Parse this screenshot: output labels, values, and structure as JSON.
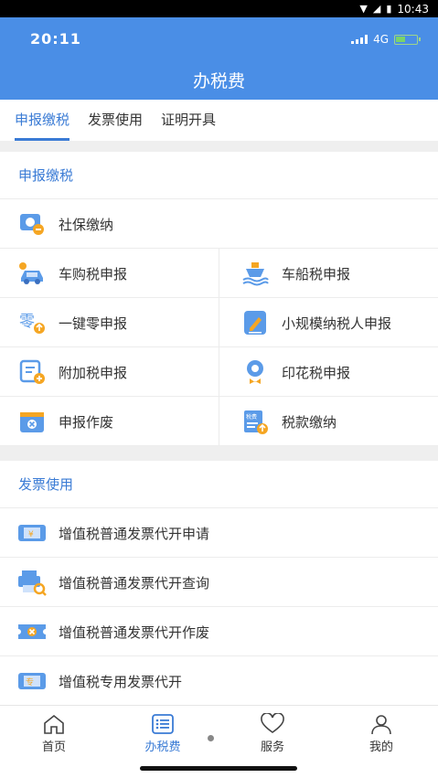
{
  "system_bar": {
    "time": "10:43"
  },
  "status_bar": {
    "time": "20:11",
    "network": "4G"
  },
  "header": {
    "title": "办税费"
  },
  "tabs": [
    {
      "label": "申报缴税",
      "active": true
    },
    {
      "label": "发票使用",
      "active": false
    },
    {
      "label": "证明开具",
      "active": false
    }
  ],
  "section_declare": {
    "title": "申报缴税",
    "items": [
      {
        "label": "社保缴纳",
        "icon": "social-security-icon"
      },
      {
        "label": "车购税申报",
        "icon": "car-icon"
      },
      {
        "label": "车船税申报",
        "icon": "ship-icon"
      },
      {
        "label": "一键零申报",
        "icon": "zero-declare-icon"
      },
      {
        "label": "小规模纳税人申报",
        "icon": "edit-document-icon"
      },
      {
        "label": "附加税申报",
        "icon": "add-form-icon"
      },
      {
        "label": "印花税申报",
        "icon": "stamp-icon"
      },
      {
        "label": "申报作废",
        "icon": "void-declare-icon"
      },
      {
        "label": "税款缴纳",
        "icon": "tax-payment-icon"
      }
    ]
  },
  "section_invoice": {
    "title": "发票使用",
    "items": [
      {
        "label": "增值税普通发票代开申请",
        "icon": "invoice-apply-icon"
      },
      {
        "label": "增值税普通发票代开查询",
        "icon": "invoice-query-icon"
      },
      {
        "label": "增值税普通发票代开作废",
        "icon": "invoice-void-icon"
      },
      {
        "label": "增值税专用发票代开",
        "icon": "special-invoice-icon"
      }
    ]
  },
  "bottom_nav": [
    {
      "label": "首页",
      "icon": "home-icon",
      "active": false
    },
    {
      "label": "办税费",
      "icon": "list-icon",
      "active": true
    },
    {
      "label": "服务",
      "icon": "heart-icon",
      "active": false
    },
    {
      "label": "我的",
      "icon": "user-icon",
      "active": false
    }
  ],
  "colors": {
    "primary": "#4a8ee6",
    "accent": "#3a7bd5",
    "icon_blue": "#5b9be8",
    "icon_orange": "#f5a623"
  }
}
